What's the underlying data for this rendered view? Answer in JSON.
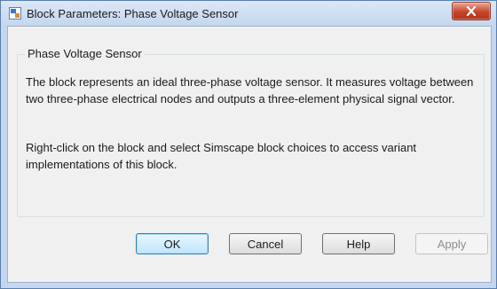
{
  "window": {
    "title": "Block Parameters: Phase Voltage Sensor"
  },
  "group": {
    "title": "Phase Voltage Sensor",
    "description_1": "The block represents an ideal three-phase voltage sensor. It measures voltage between two three-phase electrical nodes and outputs a three-element physical signal vector.",
    "description_2": "Right-click on the block and select Simscape block choices to access variant implementations of this block."
  },
  "buttons": {
    "ok": "OK",
    "cancel": "Cancel",
    "help": "Help",
    "apply": "Apply",
    "apply_enabled": false
  },
  "icons": {
    "app": "simulink-block-icon",
    "close": "close-icon"
  },
  "colors": {
    "title_bar": "#c5d7ee",
    "client_bg": "#f0f0f0",
    "close_button": "#c7452a",
    "default_button": "#bee6fd"
  }
}
